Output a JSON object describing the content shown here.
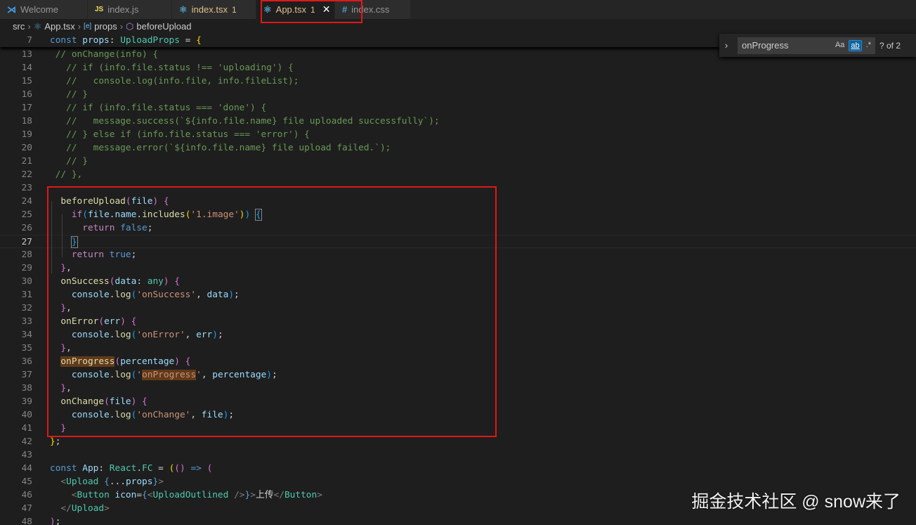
{
  "tabs": [
    {
      "label": "Welcome",
      "icon": "vscode-icon",
      "mod": ""
    },
    {
      "label": "index.js",
      "icon": "js-icon",
      "mod": ""
    },
    {
      "label": "index.tsx",
      "icon": "react-icon",
      "mod": "1"
    },
    {
      "label": "App.tsx",
      "icon": "react-icon",
      "mod": "1",
      "active": true
    },
    {
      "label": "index.css",
      "icon": "css-hash-icon",
      "mod": ""
    }
  ],
  "breadcrumb": [
    "src",
    "App.tsx",
    "props",
    "beforeUpload"
  ],
  "find": {
    "value": "onProgress",
    "case": "Aa",
    "word": "ab",
    "regex": ".*",
    "count": "? of 2"
  },
  "watermark": "掘金技术社区 @ snow来了",
  "colors": {
    "accent": "#0e639c",
    "highlight_box": "#e01818"
  },
  "sticky": {
    "n": "7",
    "tokens": [
      [
        "k",
        "const "
      ],
      [
        "v",
        "props"
      ],
      [
        "p",
        ": "
      ],
      [
        "t",
        "UploadProps"
      ],
      [
        "p",
        " = "
      ],
      [
        "b1",
        "{"
      ]
    ]
  },
  "lines": [
    {
      "n": "13",
      "tokens": [
        [
          "c",
          " // onChange(info) {"
        ]
      ]
    },
    {
      "n": "14",
      "tokens": [
        [
          "c",
          "   // if (info.file.status !== 'uploading') {"
        ]
      ]
    },
    {
      "n": "15",
      "tokens": [
        [
          "c",
          "   //   console.log(info.file, info.fileList);"
        ]
      ]
    },
    {
      "n": "16",
      "tokens": [
        [
          "c",
          "   // }"
        ]
      ]
    },
    {
      "n": "17",
      "tokens": [
        [
          "c",
          "   // if (info.file.status === 'done') {"
        ]
      ]
    },
    {
      "n": "18",
      "tokens": [
        [
          "c",
          "   //   message.success(`${info.file.name} file uploaded successfully`);"
        ]
      ]
    },
    {
      "n": "19",
      "tokens": [
        [
          "c",
          "   // } else if (info.file.status === 'error') {"
        ]
      ]
    },
    {
      "n": "20",
      "tokens": [
        [
          "c",
          "   //   message.error(`${info.file.name} file upload failed.`);"
        ]
      ]
    },
    {
      "n": "21",
      "tokens": [
        [
          "c",
          "   // }"
        ]
      ]
    },
    {
      "n": "22",
      "tokens": [
        [
          "c",
          " // },"
        ]
      ]
    },
    {
      "n": "23",
      "tokens": []
    },
    {
      "n": "24",
      "tokens": [
        [
          "p",
          "  "
        ],
        [
          "f",
          "beforeUpload"
        ],
        [
          "b2",
          "("
        ],
        [
          "v",
          "file"
        ],
        [
          "b2",
          ")"
        ],
        [
          "p",
          " "
        ],
        [
          "b2",
          "{"
        ]
      ]
    },
    {
      "n": "25",
      "tokens": [
        [
          "p",
          "    "
        ],
        [
          "kc",
          "if"
        ],
        [
          "b3",
          "("
        ],
        [
          "v",
          "file"
        ],
        [
          "p",
          "."
        ],
        [
          "v",
          "name"
        ],
        [
          "p",
          "."
        ],
        [
          "f",
          "includes"
        ],
        [
          "b1",
          "("
        ],
        [
          "s",
          "'1.image'"
        ],
        [
          "b1",
          ")"
        ],
        [
          "b3",
          ")"
        ],
        [
          "p",
          " "
        ],
        [
          "b3 bm",
          "{"
        ]
      ]
    },
    {
      "n": "26",
      "tokens": [
        [
          "p",
          "      "
        ],
        [
          "kc",
          "return"
        ],
        [
          "p",
          " "
        ],
        [
          "k",
          "false"
        ],
        [
          "p",
          ";"
        ]
      ]
    },
    {
      "n": "27",
      "cur": true,
      "tokens": [
        [
          "p",
          "    "
        ],
        [
          "b3 bm",
          "}"
        ]
      ]
    },
    {
      "n": "28",
      "tokens": [
        [
          "p",
          "    "
        ],
        [
          "kc",
          "return"
        ],
        [
          "p",
          " "
        ],
        [
          "k",
          "true"
        ],
        [
          "p",
          ";"
        ]
      ]
    },
    {
      "n": "29",
      "tokens": [
        [
          "p",
          "  "
        ],
        [
          "b2",
          "}"
        ],
        [
          "p",
          ","
        ]
      ]
    },
    {
      "n": "30",
      "tokens": [
        [
          "p",
          "  "
        ],
        [
          "f",
          "onSuccess"
        ],
        [
          "b2",
          "("
        ],
        [
          "v",
          "data"
        ],
        [
          "p",
          ": "
        ],
        [
          "t",
          "any"
        ],
        [
          "b2",
          ")"
        ],
        [
          "p",
          " "
        ],
        [
          "b2",
          "{"
        ]
      ]
    },
    {
      "n": "31",
      "tokens": [
        [
          "p",
          "    "
        ],
        [
          "v",
          "console"
        ],
        [
          "p",
          "."
        ],
        [
          "f",
          "log"
        ],
        [
          "b3",
          "("
        ],
        [
          "s",
          "'onSuccess'"
        ],
        [
          "p",
          ", "
        ],
        [
          "v",
          "data"
        ],
        [
          "b3",
          ")"
        ],
        [
          "p",
          ";"
        ]
      ]
    },
    {
      "n": "32",
      "tokens": [
        [
          "p",
          "  "
        ],
        [
          "b2",
          "}"
        ],
        [
          "p",
          ","
        ]
      ]
    },
    {
      "n": "33",
      "tokens": [
        [
          "p",
          "  "
        ],
        [
          "f",
          "onError"
        ],
        [
          "b2",
          "("
        ],
        [
          "v",
          "err"
        ],
        [
          "b2",
          ")"
        ],
        [
          "p",
          " "
        ],
        [
          "b2",
          "{"
        ]
      ]
    },
    {
      "n": "34",
      "tokens": [
        [
          "p",
          "    "
        ],
        [
          "v",
          "console"
        ],
        [
          "p",
          "."
        ],
        [
          "f",
          "log"
        ],
        [
          "b3",
          "("
        ],
        [
          "s",
          "'onError'"
        ],
        [
          "p",
          ", "
        ],
        [
          "v",
          "err"
        ],
        [
          "b3",
          ")"
        ],
        [
          "p",
          ";"
        ]
      ]
    },
    {
      "n": "35",
      "tokens": [
        [
          "p",
          "  "
        ],
        [
          "b2",
          "}"
        ],
        [
          "p",
          ","
        ]
      ]
    },
    {
      "n": "36",
      "tokens": [
        [
          "p",
          "  "
        ],
        [
          "f hl",
          "onProgress"
        ],
        [
          "b2",
          "("
        ],
        [
          "v",
          "percentage"
        ],
        [
          "b2",
          ")"
        ],
        [
          "p",
          " "
        ],
        [
          "b2",
          "{"
        ]
      ]
    },
    {
      "n": "37",
      "tokens": [
        [
          "p",
          "    "
        ],
        [
          "v",
          "console"
        ],
        [
          "p",
          "."
        ],
        [
          "f",
          "log"
        ],
        [
          "b3",
          "("
        ],
        [
          "s",
          "'"
        ],
        [
          "s hl",
          "onProgress"
        ],
        [
          "s",
          "'"
        ],
        [
          "p",
          ", "
        ],
        [
          "v",
          "percentage"
        ],
        [
          "b3",
          ")"
        ],
        [
          "p",
          ";"
        ]
      ]
    },
    {
      "n": "38",
      "tokens": [
        [
          "p",
          "  "
        ],
        [
          "b2",
          "}"
        ],
        [
          "p",
          ","
        ]
      ]
    },
    {
      "n": "39",
      "tokens": [
        [
          "p",
          "  "
        ],
        [
          "f",
          "onChange"
        ],
        [
          "b2",
          "("
        ],
        [
          "v",
          "file"
        ],
        [
          "b2",
          ")"
        ],
        [
          "p",
          " "
        ],
        [
          "b2",
          "{"
        ]
      ]
    },
    {
      "n": "40",
      "tokens": [
        [
          "p",
          "    "
        ],
        [
          "v",
          "console"
        ],
        [
          "p",
          "."
        ],
        [
          "f",
          "log"
        ],
        [
          "b3",
          "("
        ],
        [
          "s",
          "'onChange'"
        ],
        [
          "p",
          ", "
        ],
        [
          "v",
          "file"
        ],
        [
          "b3",
          ")"
        ],
        [
          "p",
          ";"
        ]
      ]
    },
    {
      "n": "41",
      "tokens": [
        [
          "p",
          "  "
        ],
        [
          "b2",
          "}"
        ]
      ]
    },
    {
      "n": "42",
      "tokens": [
        [
          "b1",
          "}"
        ],
        [
          "p",
          ";"
        ]
      ]
    },
    {
      "n": "43",
      "tokens": []
    },
    {
      "n": "44",
      "tokens": [
        [
          "k",
          "const "
        ],
        [
          "v",
          "App"
        ],
        [
          "p",
          ": "
        ],
        [
          "t",
          "React"
        ],
        [
          "p",
          "."
        ],
        [
          "t",
          "FC"
        ],
        [
          "p",
          " = "
        ],
        [
          "b1",
          "("
        ],
        [
          "b2",
          "()"
        ],
        [
          "p",
          " "
        ],
        [
          "k",
          "=>"
        ],
        [
          "p",
          " "
        ],
        [
          "b2",
          "("
        ]
      ]
    },
    {
      "n": "45",
      "tokens": [
        [
          "p",
          "  "
        ],
        [
          "tag",
          "<"
        ],
        [
          "tn",
          "Upload"
        ],
        [
          "p",
          " "
        ],
        [
          "k",
          "{"
        ],
        [
          "p",
          "..."
        ],
        [
          "v",
          "props"
        ],
        [
          "k",
          "}"
        ],
        [
          "tag",
          ">"
        ]
      ]
    },
    {
      "n": "46",
      "tokens": [
        [
          "p",
          "    "
        ],
        [
          "tag",
          "<"
        ],
        [
          "tn",
          "Button"
        ],
        [
          "p",
          " "
        ],
        [
          "at",
          "icon"
        ],
        [
          "p",
          "="
        ],
        [
          "k",
          "{"
        ],
        [
          "tag",
          "<"
        ],
        [
          "tn",
          "UploadOutlined"
        ],
        [
          "p",
          " "
        ],
        [
          "tag",
          "/>"
        ],
        [
          "k",
          "}"
        ],
        [
          "tag",
          ">"
        ],
        [
          "p",
          "上传"
        ],
        [
          "tag",
          "</"
        ],
        [
          "tn",
          "Button"
        ],
        [
          "tag",
          ">"
        ]
      ]
    },
    {
      "n": "47",
      "tokens": [
        [
          "p",
          "  "
        ],
        [
          "tag",
          "</"
        ],
        [
          "tn",
          "Upload"
        ],
        [
          "tag",
          ">"
        ]
      ]
    },
    {
      "n": "48",
      "tokens": [
        [
          "b2",
          ")"
        ],
        [
          "p",
          ";"
        ]
      ]
    }
  ]
}
